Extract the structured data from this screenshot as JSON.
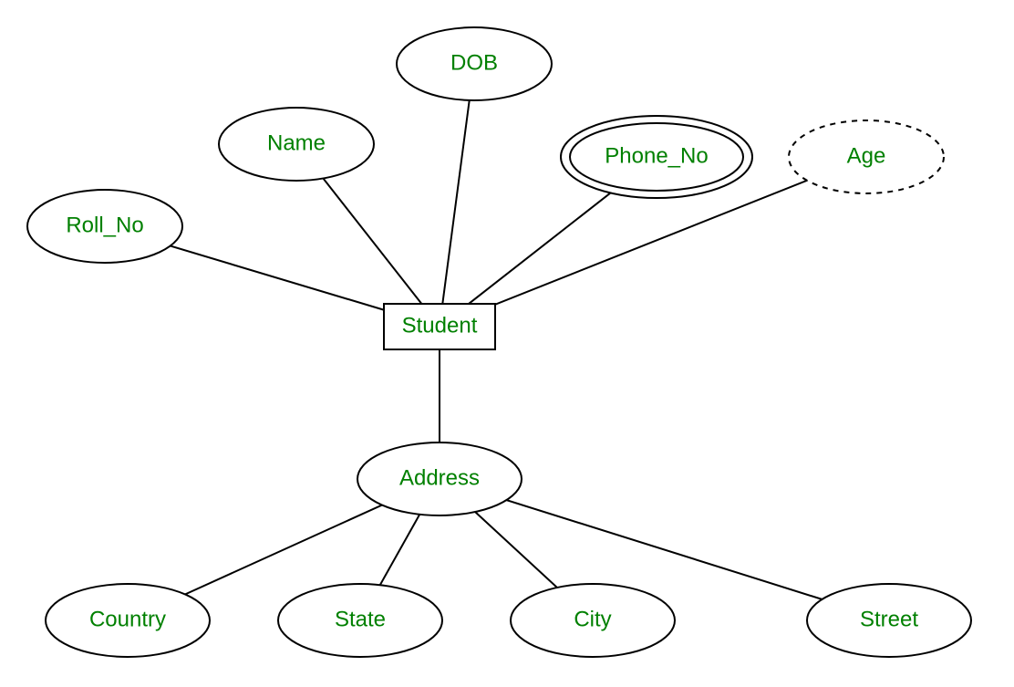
{
  "diagram": {
    "type": "entity-relationship",
    "entity": {
      "label": "Student"
    },
    "attributes": {
      "roll_no": {
        "label": "Roll_No",
        "kind": "simple"
      },
      "name": {
        "label": "Name",
        "kind": "simple"
      },
      "dob": {
        "label": "DOB",
        "kind": "simple"
      },
      "phone_no": {
        "label": "Phone_No",
        "kind": "multivalued"
      },
      "age": {
        "label": "Age",
        "kind": "derived"
      },
      "address": {
        "label": "Address",
        "kind": "composite"
      }
    },
    "address_components": {
      "country": {
        "label": "Country"
      },
      "state": {
        "label": "State"
      },
      "city": {
        "label": "City"
      },
      "street": {
        "label": "Street"
      }
    }
  }
}
